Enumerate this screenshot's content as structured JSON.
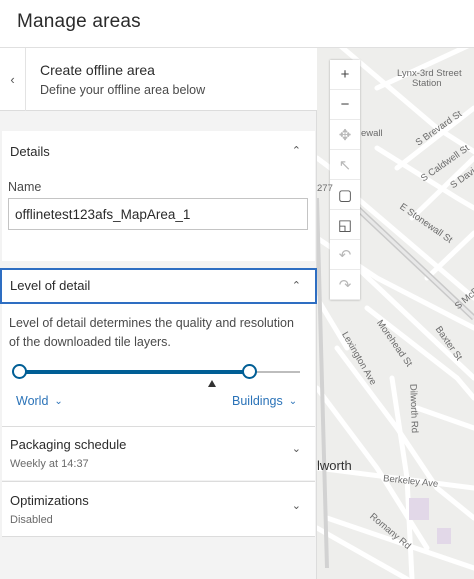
{
  "window": {
    "title": "Manage areas"
  },
  "header": {
    "title": "Create offline area",
    "subtitle": "Define your offline area below"
  },
  "details": {
    "label": "Details",
    "name_label": "Name",
    "name_value": "offlinetest123afs_MapArea_1"
  },
  "level_of_detail": {
    "label": "Level of detail",
    "description": "Level of detail determines the quality and resolution of the downloaded tile layers.",
    "min_label": "World",
    "max_label": "Buildings"
  },
  "packaging": {
    "label": "Packaging schedule",
    "value": "Weekly at 14:37"
  },
  "optimizations": {
    "label": "Optimizations",
    "value": "Disabled"
  },
  "map": {
    "labels": {
      "station": "Lynx-3rd Street",
      "station2": "Station",
      "brevard": "S Brevard St",
      "caldwell": "S Caldwell St",
      "davidson": "S Davi",
      "stonewall": "E Stonewall St",
      "mcdowell": "S McD",
      "morehead": "Morehead St",
      "baxter": "Baxter St",
      "lexington": "Lexington Ave",
      "dilworth_rd": "Dilworth Rd",
      "dilworth": "lworth",
      "berkeley": "Berkeley Ave",
      "romany": "Romany Rd",
      "stonewall_short": "ewall",
      "rt277": "277"
    }
  },
  "colors": {
    "accent": "#005e95",
    "focus": "#2e6ec2",
    "link": "#2b73b8"
  }
}
